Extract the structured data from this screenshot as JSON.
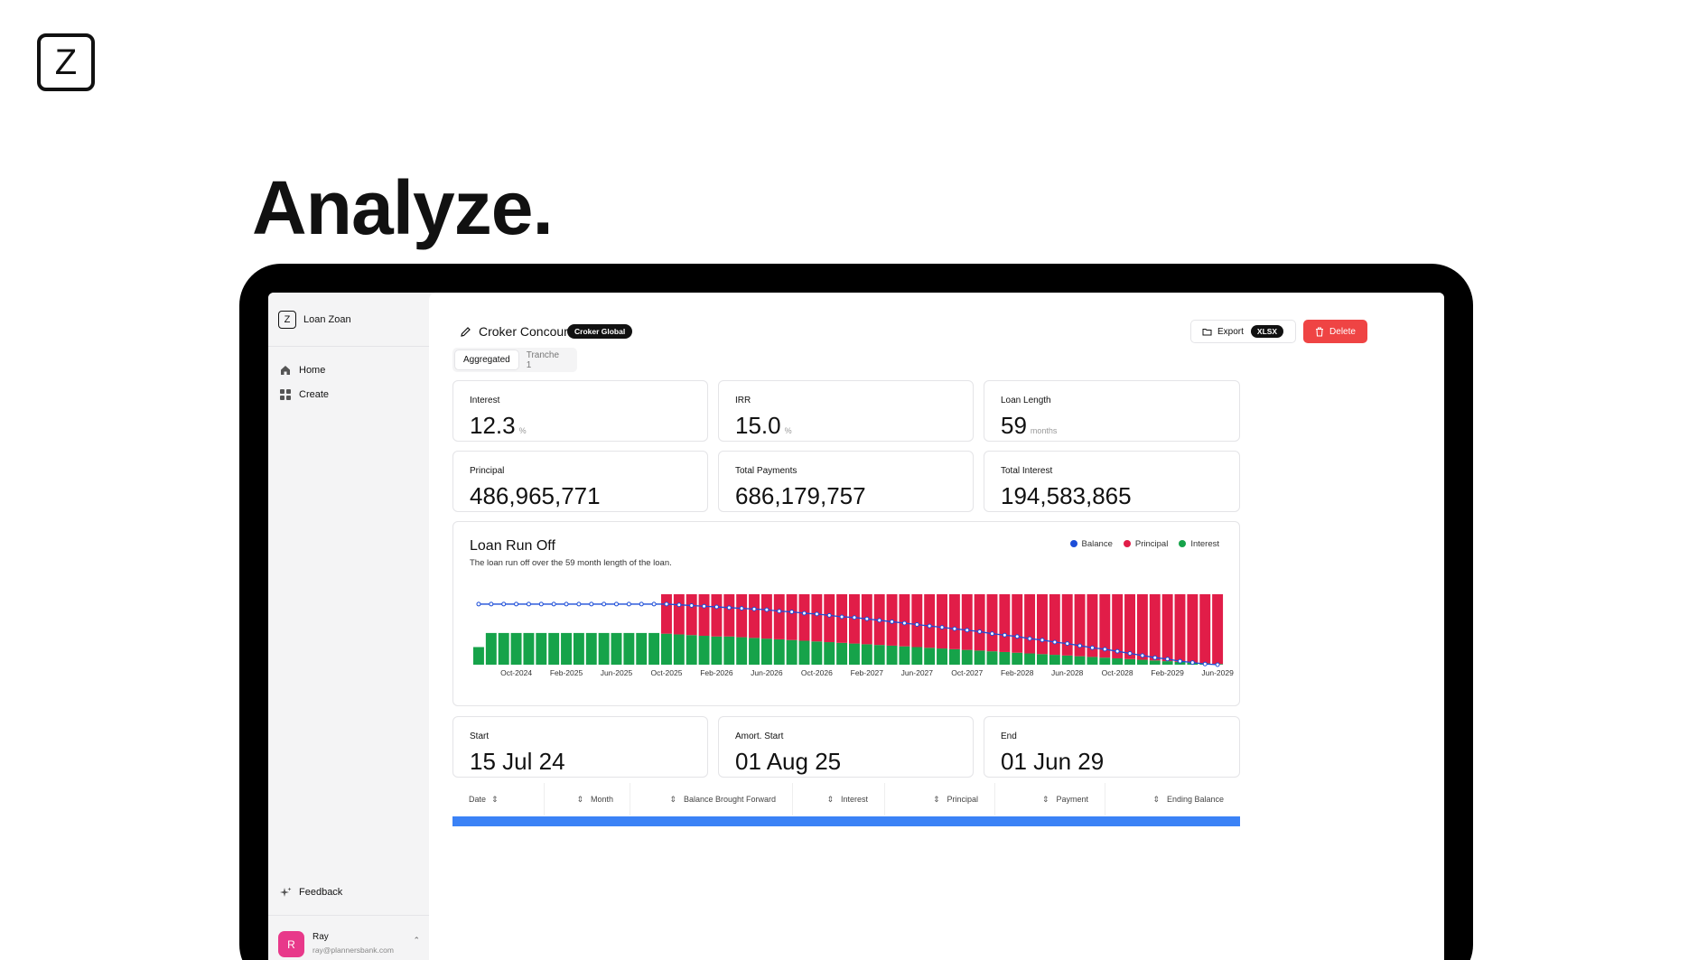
{
  "brand": {
    "logo_letter": "Z",
    "hero_title": "Analyze."
  },
  "sidebar": {
    "logo_letter": "Z",
    "app_name": "Loan Zoan",
    "items": [
      {
        "label": "Home",
        "icon": "home-icon"
      },
      {
        "label": "Create",
        "icon": "grid-icon"
      }
    ],
    "feedback_label": "Feedback",
    "user": {
      "initial": "R",
      "name": "Ray",
      "email": "ray@plannersbank.com"
    }
  },
  "header": {
    "title": "Croker Concourse",
    "badge": "Croker Global",
    "export_label": "Export",
    "export_format": "XLSX",
    "delete_label": "Delete"
  },
  "tabs": [
    {
      "label": "Aggregated",
      "active": true
    },
    {
      "label": "Tranche 1",
      "active": false
    }
  ],
  "stats": [
    {
      "label": "Interest",
      "value": "12.3",
      "unit": "%"
    },
    {
      "label": "IRR",
      "value": "15.0",
      "unit": "%"
    },
    {
      "label": "Loan Length",
      "value": "59",
      "unit": "months"
    },
    {
      "label": "Principal",
      "value": "486,965,771",
      "unit": ""
    },
    {
      "label": "Total Payments",
      "value": "686,179,757",
      "unit": ""
    },
    {
      "label": "Total Interest",
      "value": "194,583,865",
      "unit": ""
    }
  ],
  "dates": [
    {
      "label": "Start",
      "value": "15 Jul 24"
    },
    {
      "label": "Amort. Start",
      "value": "01 Aug 25"
    },
    {
      "label": "End",
      "value": "01 Jun 29"
    }
  ],
  "colors": {
    "balance": "#1d4ed8",
    "principal": "#e11d48",
    "interest": "#16a34a",
    "delete": "#ef4444",
    "table_bar": "#3b82f6"
  },
  "chart_data": {
    "type": "bar",
    "title": "Loan Run Off",
    "subtitle": "The loan run off over the 59 month length of the loan.",
    "legend": [
      "Balance",
      "Principal",
      "Interest"
    ],
    "legend_position": "top-right",
    "x_tick_labels": [
      "Oct-2024",
      "Feb-2025",
      "Jun-2025",
      "Oct-2025",
      "Feb-2026",
      "Jun-2026",
      "Oct-2026",
      "Feb-2027",
      "Jun-2027",
      "Oct-2027",
      "Feb-2028",
      "Jun-2028",
      "Oct-2028",
      "Feb-2029",
      "Jun-2029"
    ],
    "stacked": true,
    "series": [
      {
        "name": "Interest",
        "values": [
          0.25,
          0.45,
          0.45,
          0.45,
          0.45,
          0.45,
          0.45,
          0.45,
          0.45,
          0.45,
          0.45,
          0.45,
          0.45,
          0.45,
          0.45,
          0.44,
          0.43,
          0.42,
          0.41,
          0.4,
          0.4,
          0.39,
          0.38,
          0.37,
          0.36,
          0.35,
          0.34,
          0.33,
          0.32,
          0.31,
          0.3,
          0.29,
          0.28,
          0.27,
          0.26,
          0.25,
          0.24,
          0.23,
          0.22,
          0.21,
          0.2,
          0.19,
          0.18,
          0.17,
          0.16,
          0.15,
          0.14,
          0.13,
          0.12,
          0.11,
          0.1,
          0.09,
          0.08,
          0.07,
          0.06,
          0.05,
          0.04,
          0.03,
          0.02,
          0.01
        ]
      },
      {
        "name": "Principal",
        "values": [
          0,
          0,
          0,
          0,
          0,
          0,
          0,
          0,
          0,
          0,
          0,
          0,
          0,
          0,
          0,
          0.56,
          0.57,
          0.58,
          0.59,
          0.6,
          0.6,
          0.61,
          0.62,
          0.63,
          0.64,
          0.65,
          0.66,
          0.67,
          0.68,
          0.69,
          0.7,
          0.71,
          0.72,
          0.73,
          0.74,
          0.75,
          0.76,
          0.77,
          0.78,
          0.79,
          0.8,
          0.81,
          0.82,
          0.83,
          0.84,
          0.85,
          0.86,
          0.87,
          0.88,
          0.89,
          0.9,
          0.91,
          0.92,
          0.93,
          0.94,
          0.95,
          0.96,
          0.97,
          0.98,
          0.99
        ]
      },
      {
        "name": "Balance",
        "type": "line",
        "values": [
          0.86,
          0.86,
          0.86,
          0.86,
          0.86,
          0.86,
          0.86,
          0.86,
          0.86,
          0.86,
          0.86,
          0.86,
          0.86,
          0.86,
          0.86,
          0.86,
          0.85,
          0.84,
          0.83,
          0.82,
          0.81,
          0.8,
          0.79,
          0.78,
          0.76,
          0.75,
          0.73,
          0.72,
          0.7,
          0.68,
          0.67,
          0.65,
          0.63,
          0.61,
          0.59,
          0.57,
          0.55,
          0.53,
          0.51,
          0.49,
          0.47,
          0.44,
          0.42,
          0.4,
          0.37,
          0.35,
          0.32,
          0.3,
          0.27,
          0.24,
          0.22,
          0.19,
          0.16,
          0.13,
          0.1,
          0.08,
          0.05,
          0.03,
          0.01,
          0.0
        ]
      }
    ]
  },
  "table": {
    "columns": [
      "Date",
      "Month",
      "Balance Brought Forward",
      "Interest",
      "Principal",
      "Payment",
      "Ending Balance"
    ]
  }
}
